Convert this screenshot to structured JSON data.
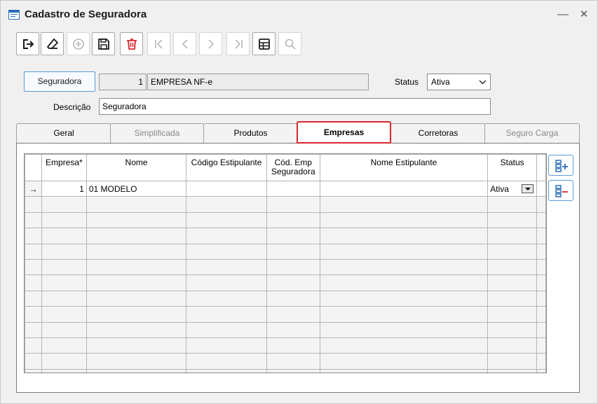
{
  "window": {
    "title": "Cadastro de Seguradora",
    "minimize_glyph": "—",
    "close_glyph": "✕"
  },
  "toolbar": {
    "buttons": [
      {
        "icon": "exit-icon",
        "enabled": true
      },
      {
        "icon": "eraser-icon",
        "enabled": true
      },
      {
        "icon": "add-circle-icon",
        "enabled": false
      },
      {
        "icon": "save-icon",
        "enabled": true
      },
      {
        "icon": "delete-icon",
        "enabled": true
      },
      {
        "icon": "first-record-icon",
        "enabled": false
      },
      {
        "icon": "previous-record-icon",
        "enabled": false
      },
      {
        "icon": "next-record-icon",
        "enabled": false
      },
      {
        "icon": "last-record-icon",
        "enabled": false
      },
      {
        "icon": "grid-view-icon",
        "enabled": true
      },
      {
        "icon": "search-icon",
        "enabled": false
      }
    ]
  },
  "form": {
    "seguradora_button": "Seguradora",
    "codigo": "1",
    "nome": "EMPRESA NF-e",
    "status_label": "Status",
    "status_value": "Ativa",
    "descricao_label": "Descrição",
    "descricao_value": "Seguradora"
  },
  "tabs": [
    {
      "label": "Geral",
      "state": "normal"
    },
    {
      "label": "Simplificada",
      "state": "disabled"
    },
    {
      "label": "Produtos",
      "state": "normal"
    },
    {
      "label": "Empresas",
      "state": "active"
    },
    {
      "label": "Corretoras",
      "state": "normal"
    },
    {
      "label": "Seguro Carga",
      "state": "disabled"
    }
  ],
  "grid": {
    "columns": [
      "",
      "Empresa*",
      "Nome",
      "Código Estipulante",
      "Cód. Emp Seguradora",
      "Nome Estipulante",
      "Status"
    ],
    "rows": [
      {
        "indicator": "→",
        "empresa": "1",
        "nome": "01 MODELO",
        "codigo_estipulante": "",
        "cod_emp_seguradora": "",
        "nome_estipulante": "",
        "status": "Ativa"
      }
    ],
    "side_buttons": [
      {
        "icon": "add-row-icon",
        "color": "#2a6fb8"
      },
      {
        "icon": "remove-row-icon",
        "color": "#d9272d"
      }
    ]
  },
  "colors": {
    "accent_blue": "#2a6fb8",
    "accent_red": "#d9272d"
  }
}
